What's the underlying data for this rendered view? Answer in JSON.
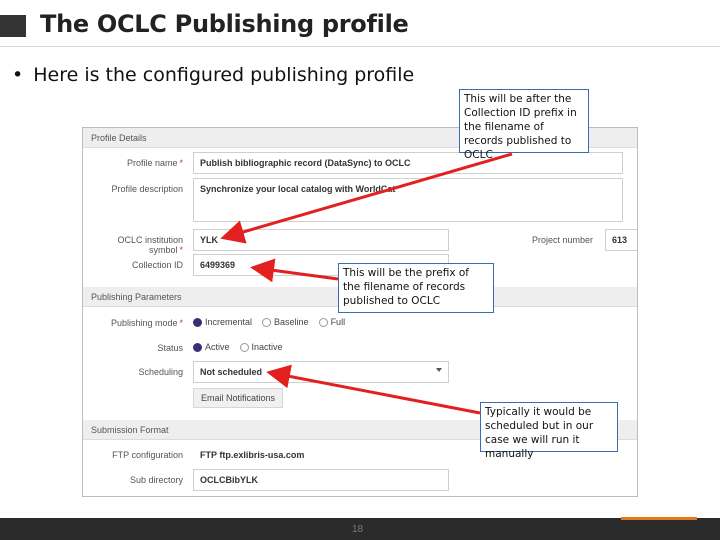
{
  "slide": {
    "title": "The OCLC Publishing profile",
    "bullet": "Here is the configured publishing profile",
    "page_number": "18"
  },
  "profile": {
    "sections": {
      "details": "Profile Details",
      "parameters": "Publishing Parameters",
      "submission": "Submission Format"
    },
    "profile_name": {
      "label": "Profile name",
      "value": "Publish bibliographic record (DataSync) to OCLC"
    },
    "profile_description": {
      "label": "Profile description",
      "value": "Synchronize your local catalog with WorldCat"
    },
    "institution_symbol": {
      "label": "OCLC institution symbol",
      "value": "YLK"
    },
    "project_number": {
      "label": "Project number",
      "value": "613"
    },
    "collection_id": {
      "label": "Collection ID",
      "value": "6499369"
    },
    "publishing_mode": {
      "label": "Publishing mode",
      "options": [
        "Incremental",
        "Baseline",
        "Full"
      ],
      "selected": "Incremental"
    },
    "status": {
      "label": "Status",
      "options": [
        "Active",
        "Inactive"
      ],
      "selected": "Active"
    },
    "scheduling": {
      "label": "Scheduling",
      "value": "Not scheduled"
    },
    "email_button": "Email Notifications",
    "ftp_configuration": {
      "label": "FTP configuration",
      "value": "FTP ftp.exlibris-usa.com"
    },
    "sub_directory": {
      "label": "Sub directory",
      "value": "OCLCBibYLK"
    }
  },
  "callouts": {
    "collection_prefix": "This will be after the Collection ID prefix in the filename of records published to OCLC",
    "filename_prefix": "This will be the prefix of the filename of records published to OCLC",
    "scheduling_note": "Typically it would be scheduled but in our case we will run it manually"
  },
  "colors": {
    "callout_border": "#3a6bb5",
    "arrow": "#e32020",
    "radio_selected": "#3c2d7a",
    "footer": "#2b2b2b"
  }
}
